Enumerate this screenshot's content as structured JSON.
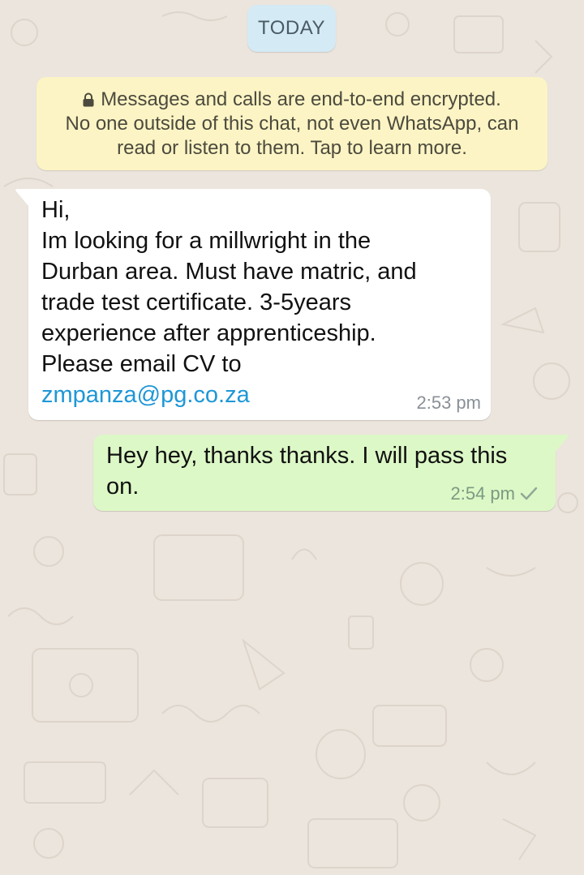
{
  "date_divider": "TODAY",
  "encryption_notice": {
    "line1": "Messages and calls are end-to-end encrypted.",
    "line2": "No one outside of this chat, not even WhatsApp, can",
    "line3": "read or listen to them. Tap to learn more.",
    "icon": "lock-icon"
  },
  "messages": [
    {
      "direction": "incoming",
      "body": "Hi,\nIm looking for a millwright in the\nDurban area. Must have matric, and\ntrade test certificate. 3-5years\nexperience after apprenticeship.\nPlease email CV to",
      "link": "zmpanza@pg.co.za",
      "time": "2:53 pm"
    },
    {
      "direction": "outgoing",
      "body": "Hey hey, thanks thanks. I will pass this on.",
      "time": "2:54 pm",
      "status_icon": "single-check-icon"
    }
  ],
  "colors": {
    "wallpaper": "#ECE5DD",
    "incoming_bubble": "#FFFFFF",
    "outgoing_bubble": "#DCF8C6",
    "notice_bg": "#FCF4C4",
    "date_chip_bg": "#D4EAF4",
    "link": "#1E97D6"
  }
}
